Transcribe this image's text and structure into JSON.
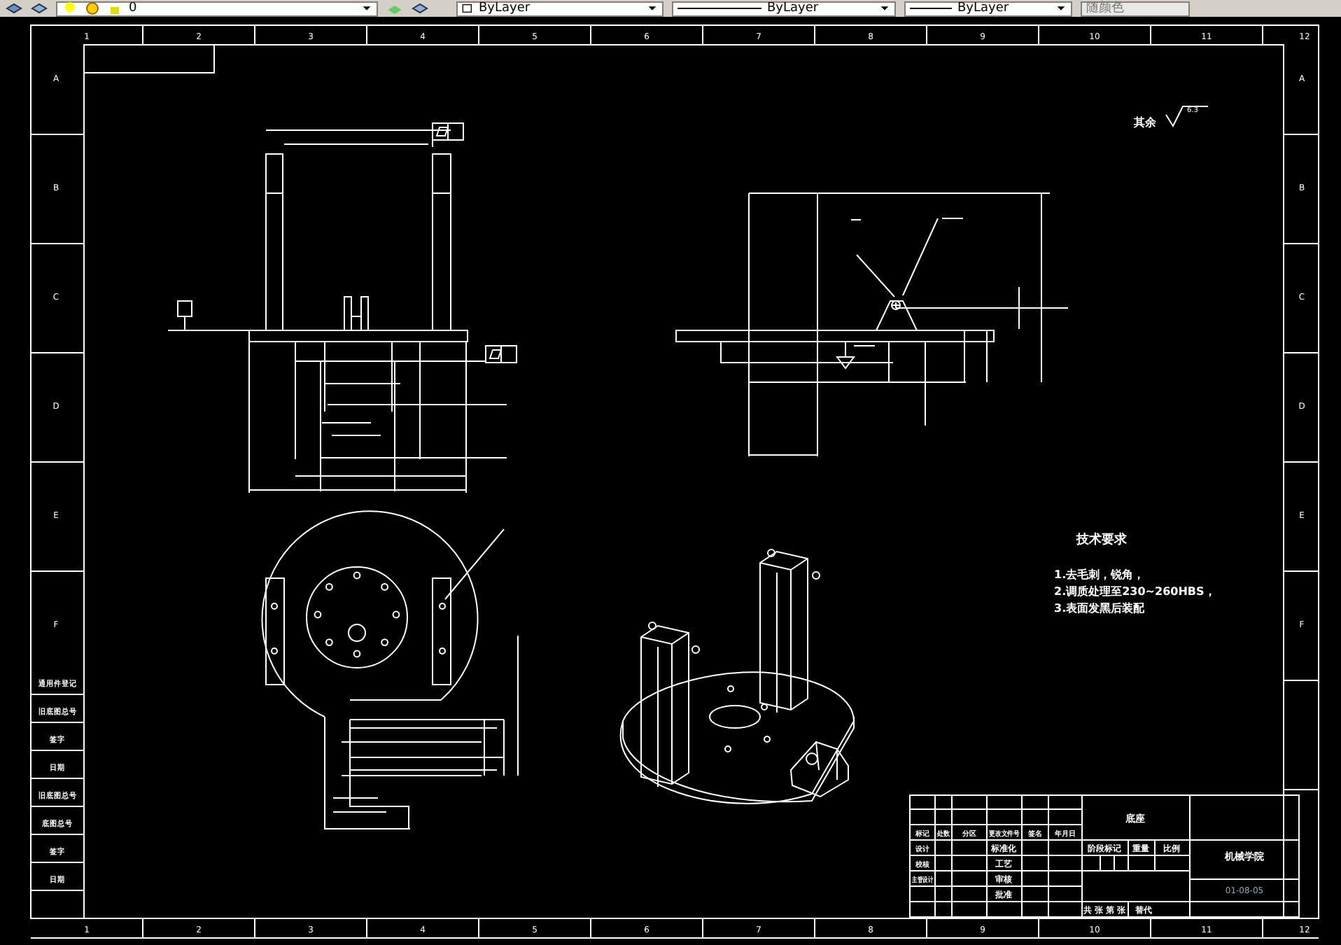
{
  "toolbar": {
    "layer": "0",
    "color_setting": "ByLayer",
    "linetype": "ByLayer",
    "lineweight": "ByLayer",
    "plot_style": "随颜色"
  },
  "border": {
    "top_columns": [
      "1",
      "2",
      "3",
      "4",
      "5",
      "6",
      "7",
      "8",
      "9",
      "10",
      "11",
      "12"
    ],
    "bottom_columns": [
      "1",
      "2",
      "3",
      "4",
      "5",
      "6",
      "7",
      "8",
      "9",
      "10",
      "11",
      "12"
    ],
    "left_rows": [
      "A",
      "B",
      "C",
      "D",
      "E",
      "F"
    ],
    "right_rows": [
      "A",
      "B",
      "C",
      "D",
      "E",
      "F"
    ]
  },
  "roughness_note": {
    "label": "其余",
    "value": "6.3"
  },
  "technical_requirements": {
    "title": "技术要求",
    "items": [
      "1.去毛刺，锐角，",
      "2.调质处理至230~260HBS，",
      "3.表面发黑后装配"
    ]
  },
  "side_table": [
    "通用件登记",
    "旧底图总号",
    "签字",
    "日期",
    "旧底图总号",
    "底图总号",
    "签字",
    "日期"
  ],
  "title_block": {
    "revision_headers": [
      "标记",
      "处数",
      "分区",
      "更改文件号",
      "签名",
      "年月日"
    ],
    "roles_left": [
      "设计",
      "校核",
      "主管设计"
    ],
    "roles_right": [
      "标准化",
      "工艺",
      "审核",
      "批准"
    ],
    "part_name": "底座",
    "stage_label": "阶段标记",
    "weight_label": "重量",
    "scale_label": "比例",
    "sheet_label": "共 张 第 张",
    "version_label": "替代",
    "organization": "机械学院",
    "drawing_number": "01-08-05"
  }
}
